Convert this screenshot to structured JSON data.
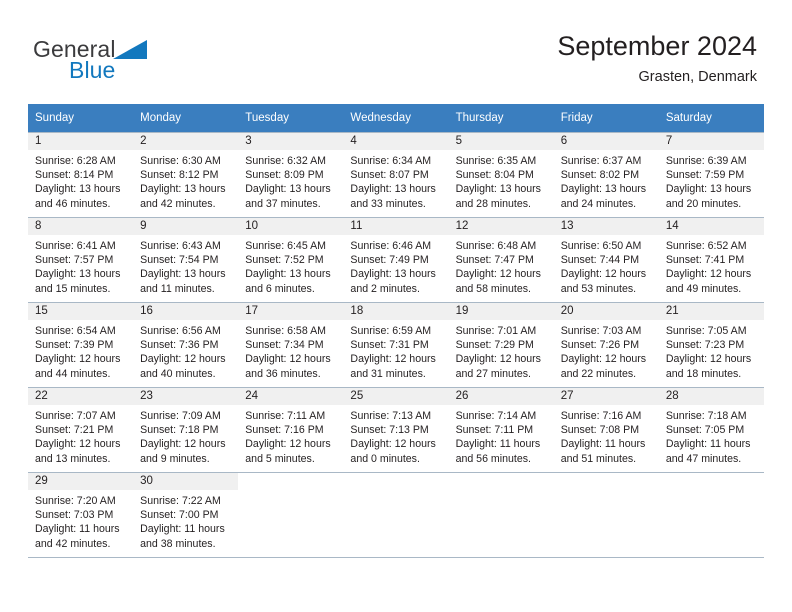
{
  "brand": {
    "name_part1": "General",
    "name_part2": "Blue",
    "triangle_icon": "triangle-icon",
    "color_dark": "#3b3b3d",
    "color_blue": "#1278be"
  },
  "header": {
    "title": "September 2024",
    "location": "Grasten, Denmark"
  },
  "theme": {
    "header_bg": "#3a7ebf",
    "header_text": "#ffffff",
    "daynum_band_bg": "#f0f0f0",
    "grid_line": "#a9b8c6",
    "body_text": "#231f20"
  },
  "weekdays": [
    "Sunday",
    "Monday",
    "Tuesday",
    "Wednesday",
    "Thursday",
    "Friday",
    "Saturday"
  ],
  "labels": {
    "sunrise_prefix": "Sunrise:",
    "sunset_prefix": "Sunset:",
    "daylight_prefix": "Daylight:"
  },
  "weeks": [
    [
      {
        "day": "1",
        "sunrise": "Sunrise: 6:28 AM",
        "sunset": "Sunset: 8:14 PM",
        "daylight_line1": "Daylight: 13 hours",
        "daylight_line2": "and 46 minutes."
      },
      {
        "day": "2",
        "sunrise": "Sunrise: 6:30 AM",
        "sunset": "Sunset: 8:12 PM",
        "daylight_line1": "Daylight: 13 hours",
        "daylight_line2": "and 42 minutes."
      },
      {
        "day": "3",
        "sunrise": "Sunrise: 6:32 AM",
        "sunset": "Sunset: 8:09 PM",
        "daylight_line1": "Daylight: 13 hours",
        "daylight_line2": "and 37 minutes."
      },
      {
        "day": "4",
        "sunrise": "Sunrise: 6:34 AM",
        "sunset": "Sunset: 8:07 PM",
        "daylight_line1": "Daylight: 13 hours",
        "daylight_line2": "and 33 minutes."
      },
      {
        "day": "5",
        "sunrise": "Sunrise: 6:35 AM",
        "sunset": "Sunset: 8:04 PM",
        "daylight_line1": "Daylight: 13 hours",
        "daylight_line2": "and 28 minutes."
      },
      {
        "day": "6",
        "sunrise": "Sunrise: 6:37 AM",
        "sunset": "Sunset: 8:02 PM",
        "daylight_line1": "Daylight: 13 hours",
        "daylight_line2": "and 24 minutes."
      },
      {
        "day": "7",
        "sunrise": "Sunrise: 6:39 AM",
        "sunset": "Sunset: 7:59 PM",
        "daylight_line1": "Daylight: 13 hours",
        "daylight_line2": "and 20 minutes."
      }
    ],
    [
      {
        "day": "8",
        "sunrise": "Sunrise: 6:41 AM",
        "sunset": "Sunset: 7:57 PM",
        "daylight_line1": "Daylight: 13 hours",
        "daylight_line2": "and 15 minutes."
      },
      {
        "day": "9",
        "sunrise": "Sunrise: 6:43 AM",
        "sunset": "Sunset: 7:54 PM",
        "daylight_line1": "Daylight: 13 hours",
        "daylight_line2": "and 11 minutes."
      },
      {
        "day": "10",
        "sunrise": "Sunrise: 6:45 AM",
        "sunset": "Sunset: 7:52 PM",
        "daylight_line1": "Daylight: 13 hours",
        "daylight_line2": "and 6 minutes."
      },
      {
        "day": "11",
        "sunrise": "Sunrise: 6:46 AM",
        "sunset": "Sunset: 7:49 PM",
        "daylight_line1": "Daylight: 13 hours",
        "daylight_line2": "and 2 minutes."
      },
      {
        "day": "12",
        "sunrise": "Sunrise: 6:48 AM",
        "sunset": "Sunset: 7:47 PM",
        "daylight_line1": "Daylight: 12 hours",
        "daylight_line2": "and 58 minutes."
      },
      {
        "day": "13",
        "sunrise": "Sunrise: 6:50 AM",
        "sunset": "Sunset: 7:44 PM",
        "daylight_line1": "Daylight: 12 hours",
        "daylight_line2": "and 53 minutes."
      },
      {
        "day": "14",
        "sunrise": "Sunrise: 6:52 AM",
        "sunset": "Sunset: 7:41 PM",
        "daylight_line1": "Daylight: 12 hours",
        "daylight_line2": "and 49 minutes."
      }
    ],
    [
      {
        "day": "15",
        "sunrise": "Sunrise: 6:54 AM",
        "sunset": "Sunset: 7:39 PM",
        "daylight_line1": "Daylight: 12 hours",
        "daylight_line2": "and 44 minutes."
      },
      {
        "day": "16",
        "sunrise": "Sunrise: 6:56 AM",
        "sunset": "Sunset: 7:36 PM",
        "daylight_line1": "Daylight: 12 hours",
        "daylight_line2": "and 40 minutes."
      },
      {
        "day": "17",
        "sunrise": "Sunrise: 6:58 AM",
        "sunset": "Sunset: 7:34 PM",
        "daylight_line1": "Daylight: 12 hours",
        "daylight_line2": "and 36 minutes."
      },
      {
        "day": "18",
        "sunrise": "Sunrise: 6:59 AM",
        "sunset": "Sunset: 7:31 PM",
        "daylight_line1": "Daylight: 12 hours",
        "daylight_line2": "and 31 minutes."
      },
      {
        "day": "19",
        "sunrise": "Sunrise: 7:01 AM",
        "sunset": "Sunset: 7:29 PM",
        "daylight_line1": "Daylight: 12 hours",
        "daylight_line2": "and 27 minutes."
      },
      {
        "day": "20",
        "sunrise": "Sunrise: 7:03 AM",
        "sunset": "Sunset: 7:26 PM",
        "daylight_line1": "Daylight: 12 hours",
        "daylight_line2": "and 22 minutes."
      },
      {
        "day": "21",
        "sunrise": "Sunrise: 7:05 AM",
        "sunset": "Sunset: 7:23 PM",
        "daylight_line1": "Daylight: 12 hours",
        "daylight_line2": "and 18 minutes."
      }
    ],
    [
      {
        "day": "22",
        "sunrise": "Sunrise: 7:07 AM",
        "sunset": "Sunset: 7:21 PM",
        "daylight_line1": "Daylight: 12 hours",
        "daylight_line2": "and 13 minutes."
      },
      {
        "day": "23",
        "sunrise": "Sunrise: 7:09 AM",
        "sunset": "Sunset: 7:18 PM",
        "daylight_line1": "Daylight: 12 hours",
        "daylight_line2": "and 9 minutes."
      },
      {
        "day": "24",
        "sunrise": "Sunrise: 7:11 AM",
        "sunset": "Sunset: 7:16 PM",
        "daylight_line1": "Daylight: 12 hours",
        "daylight_line2": "and 5 minutes."
      },
      {
        "day": "25",
        "sunrise": "Sunrise: 7:13 AM",
        "sunset": "Sunset: 7:13 PM",
        "daylight_line1": "Daylight: 12 hours",
        "daylight_line2": "and 0 minutes."
      },
      {
        "day": "26",
        "sunrise": "Sunrise: 7:14 AM",
        "sunset": "Sunset: 7:11 PM",
        "daylight_line1": "Daylight: 11 hours",
        "daylight_line2": "and 56 minutes."
      },
      {
        "day": "27",
        "sunrise": "Sunrise: 7:16 AM",
        "sunset": "Sunset: 7:08 PM",
        "daylight_line1": "Daylight: 11 hours",
        "daylight_line2": "and 51 minutes."
      },
      {
        "day": "28",
        "sunrise": "Sunrise: 7:18 AM",
        "sunset": "Sunset: 7:05 PM",
        "daylight_line1": "Daylight: 11 hours",
        "daylight_line2": "and 47 minutes."
      }
    ],
    [
      {
        "day": "29",
        "sunrise": "Sunrise: 7:20 AM",
        "sunset": "Sunset: 7:03 PM",
        "daylight_line1": "Daylight: 11 hours",
        "daylight_line2": "and 42 minutes."
      },
      {
        "day": "30",
        "sunrise": "Sunrise: 7:22 AM",
        "sunset": "Sunset: 7:00 PM",
        "daylight_line1": "Daylight: 11 hours",
        "daylight_line2": "and 38 minutes."
      },
      {
        "day": "",
        "sunrise": "",
        "sunset": "",
        "daylight_line1": "",
        "daylight_line2": ""
      },
      {
        "day": "",
        "sunrise": "",
        "sunset": "",
        "daylight_line1": "",
        "daylight_line2": ""
      },
      {
        "day": "",
        "sunrise": "",
        "sunset": "",
        "daylight_line1": "",
        "daylight_line2": ""
      },
      {
        "day": "",
        "sunrise": "",
        "sunset": "",
        "daylight_line1": "",
        "daylight_line2": ""
      },
      {
        "day": "",
        "sunrise": "",
        "sunset": "",
        "daylight_line1": "",
        "daylight_line2": ""
      }
    ]
  ]
}
